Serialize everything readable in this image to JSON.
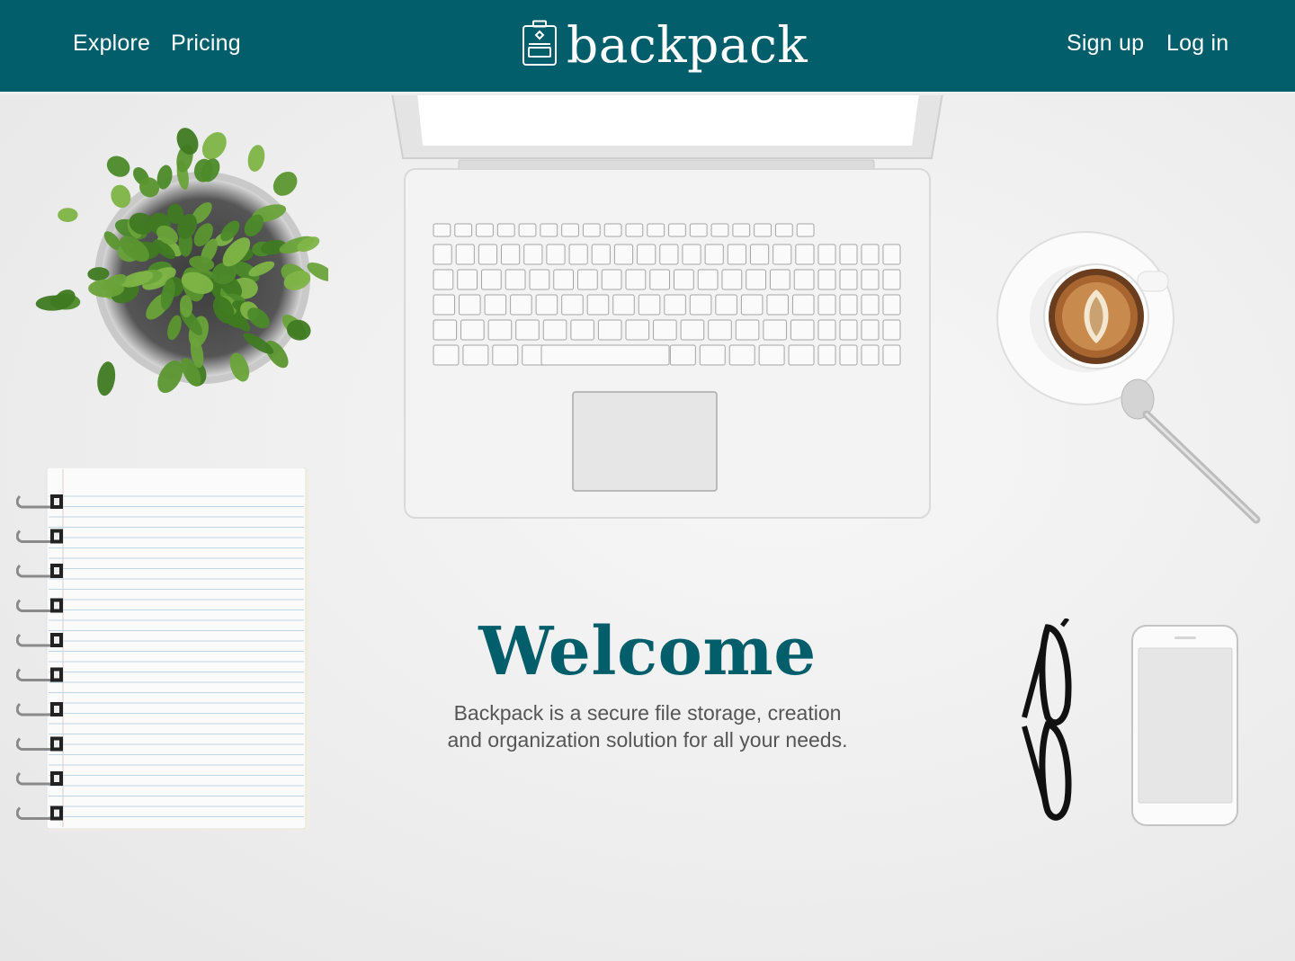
{
  "nav": {
    "explore": "Explore",
    "pricing": "Pricing",
    "sign_up": "Sign up",
    "log_in": "Log in"
  },
  "brand": {
    "name": "backpack",
    "icon": "backpack-icon"
  },
  "hero": {
    "title": "Welcome",
    "subtitle_line1": "Backpack is a secure file storage, creation",
    "subtitle_line2": "and organization solution for all your needs."
  },
  "theme": {
    "primary": "#035e6b",
    "nav_text": "#ffffff",
    "body_text": "#555555",
    "background": "#ececec"
  }
}
